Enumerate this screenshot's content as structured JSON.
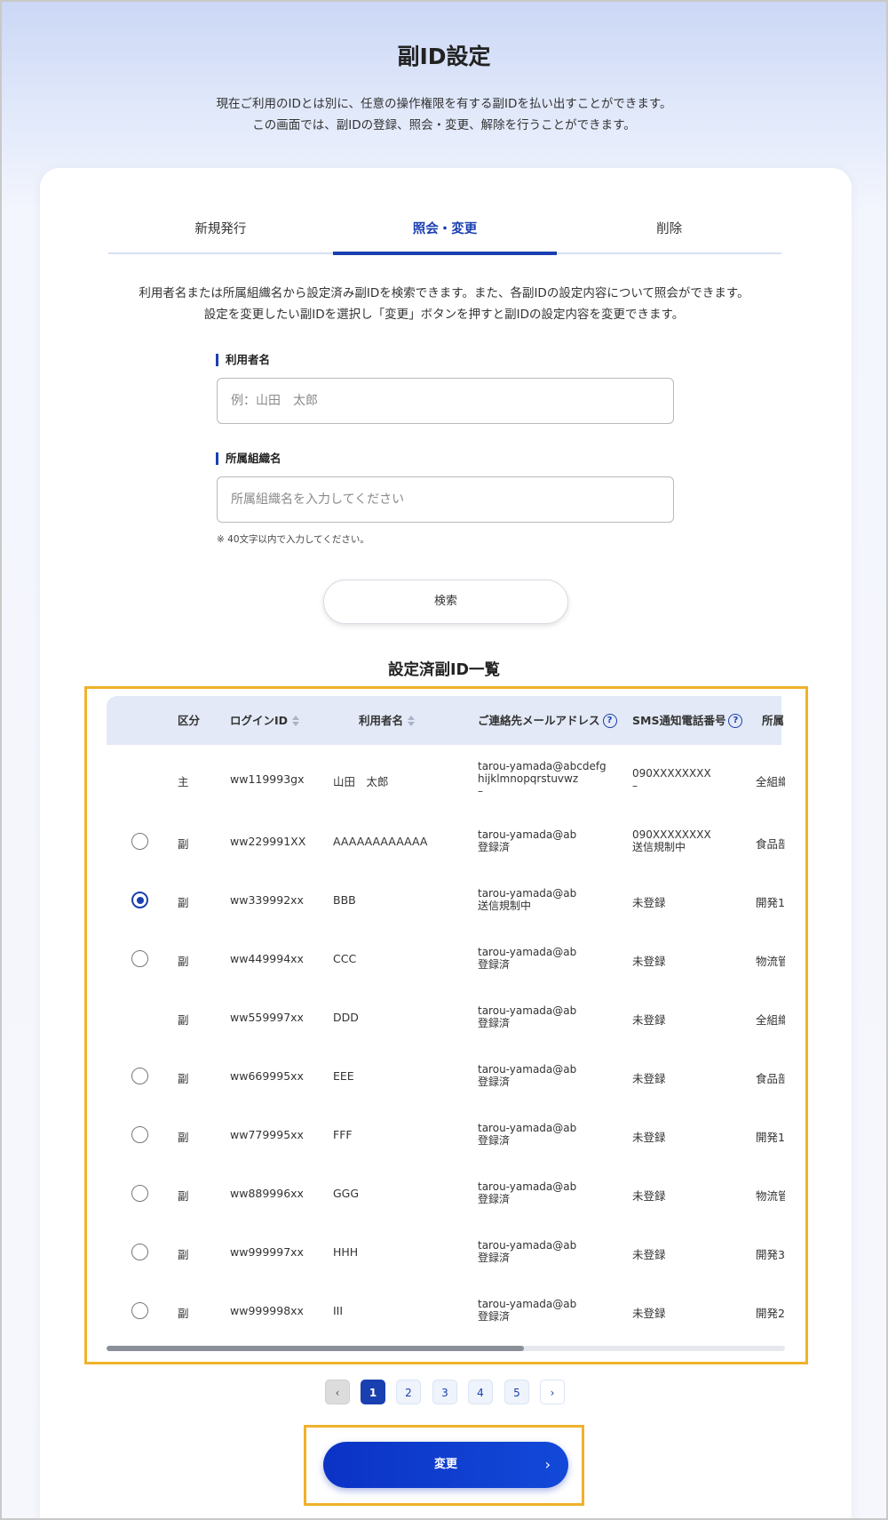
{
  "header": {
    "title": "副ID設定",
    "desc_line1": "現在ご利用のIDとは別に、任意の操作権限を有する副IDを払い出すことができます。",
    "desc_line2": "この画面では、副IDの登録、照会・変更、解除を行うことができます。"
  },
  "tabs": [
    {
      "label": "新規発行"
    },
    {
      "label": "照会・変更"
    },
    {
      "label": "削除"
    }
  ],
  "intro": {
    "line1": "利用者名または所属組織名から設定済み副IDを検索できます。また、各副IDの設定内容について照会ができます。",
    "line2": "設定を変更したい副IDを選択し「変更」ボタンを押すと副IDの設定内容を変更できます。"
  },
  "form": {
    "user_label": "利用者名",
    "user_placeholder": "例：山田　太郎",
    "org_label": "所属組織名",
    "org_placeholder": "所属組織名を入力してください",
    "note": "※ 40文字以内で入力してください。",
    "search_label": "検索"
  },
  "list": {
    "title": "設定済副ID一覧",
    "headers": {
      "kubun": "区分",
      "login_id": "ログインID",
      "user_name": "利用者名",
      "email": "ご連絡先メールアドレス",
      "sms": "SMS通知電話番号",
      "org": "所属"
    },
    "help_glyph": "?",
    "rows": [
      {
        "kubun": "主",
        "login_id": "ww119993gx",
        "user_name": "山田　太郎",
        "email_1": "tarou-yamada@abcdefg",
        "email_2": "hijklmnopqrstuvwz",
        "email_3": "–",
        "sms_1": "090XXXXXXXX",
        "sms_2": "–",
        "org": "全組織"
      },
      {
        "kubun": "副",
        "login_id": "ww229991XX",
        "user_name": "AAAAAAAAAAAA",
        "email_1": "tarou-yamada@ab",
        "email_2": "登録済",
        "sms_1": "090XXXXXXXX",
        "sms_2": "送信規制中",
        "org": "食品部"
      },
      {
        "kubun": "副",
        "login_id": "ww339992xx",
        "user_name": "BBB",
        "email_1": "tarou-yamada@ab",
        "email_2": "送信規制中",
        "sms_1": "未登録",
        "org": "開発1"
      },
      {
        "kubun": "副",
        "login_id": "ww449994xx",
        "user_name": "CCC",
        "email_1": "tarou-yamada@ab",
        "email_2": "登録済",
        "sms_1": "未登録",
        "org": "物流管"
      },
      {
        "kubun": "副",
        "login_id": "ww559997xx",
        "user_name": "DDD",
        "email_1": "tarou-yamada@ab",
        "email_2": "登録済",
        "sms_1": "未登録",
        "org": "全組織"
      },
      {
        "kubun": "副",
        "login_id": "ww669995xx",
        "user_name": "EEE",
        "email_1": "tarou-yamada@ab",
        "email_2": "登録済",
        "sms_1": "未登録",
        "org": "食品部"
      },
      {
        "kubun": "副",
        "login_id": "ww779995xx",
        "user_name": "FFF",
        "email_1": "tarou-yamada@ab",
        "email_2": "登録済",
        "sms_1": "未登録",
        "org": "開発1"
      },
      {
        "kubun": "副",
        "login_id": "ww889996xx",
        "user_name": "GGG",
        "email_1": "tarou-yamada@ab",
        "email_2": "登録済",
        "sms_1": "未登録",
        "org": "物流管"
      },
      {
        "kubun": "副",
        "login_id": "ww999997xx",
        "user_name": "HHH",
        "email_1": "tarou-yamada@ab",
        "email_2": "登録済",
        "sms_1": "未登録",
        "org": "開発3"
      },
      {
        "kubun": "副",
        "login_id": "ww999998xx",
        "user_name": "III",
        "email_1": "tarou-yamada@ab",
        "email_2": "登録済",
        "sms_1": "未登録",
        "org": "開発2"
      }
    ]
  },
  "pagination": {
    "prev": "‹",
    "pages": [
      "1",
      "2",
      "3",
      "4",
      "5"
    ],
    "next": "›"
  },
  "actions": {
    "change_label": "変更",
    "change_chevron": "›"
  },
  "colors": {
    "accent": "#1a3fb0",
    "highlight": "#f0b22b"
  }
}
